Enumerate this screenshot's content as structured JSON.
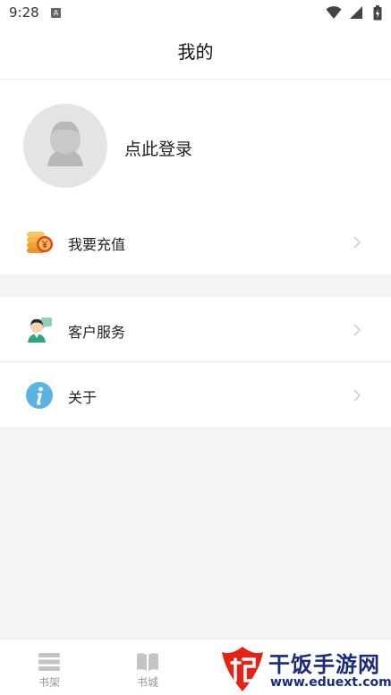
{
  "status": {
    "time": "9:28",
    "notification_icon": "A"
  },
  "header": {
    "title": "我的"
  },
  "profile": {
    "login_text": "点此登录",
    "avatar_icon": "default-avatar-icon"
  },
  "menu": {
    "recharge": {
      "label": "我要充值",
      "icon": "coins-icon"
    },
    "service": {
      "label": "客户服务",
      "icon": "customer-service-icon"
    },
    "about": {
      "label": "关于",
      "icon": "info-icon"
    }
  },
  "tabs": [
    {
      "label": "书架",
      "icon": "bookshelf-icon"
    },
    {
      "label": "书城",
      "icon": "book-icon"
    }
  ],
  "watermark": {
    "text": "干饭手游网",
    "url": "www.eduext.com"
  },
  "colors": {
    "background": "#f4f4f4",
    "card": "#ffffff",
    "avatar_bg": "#e4e4e4",
    "info_blue": "#5bb3e3",
    "coin_orange": "#f0a236",
    "inactive_tab": "#999999",
    "watermark_red": "#e2231a",
    "watermark_navy": "#1c2a78"
  }
}
